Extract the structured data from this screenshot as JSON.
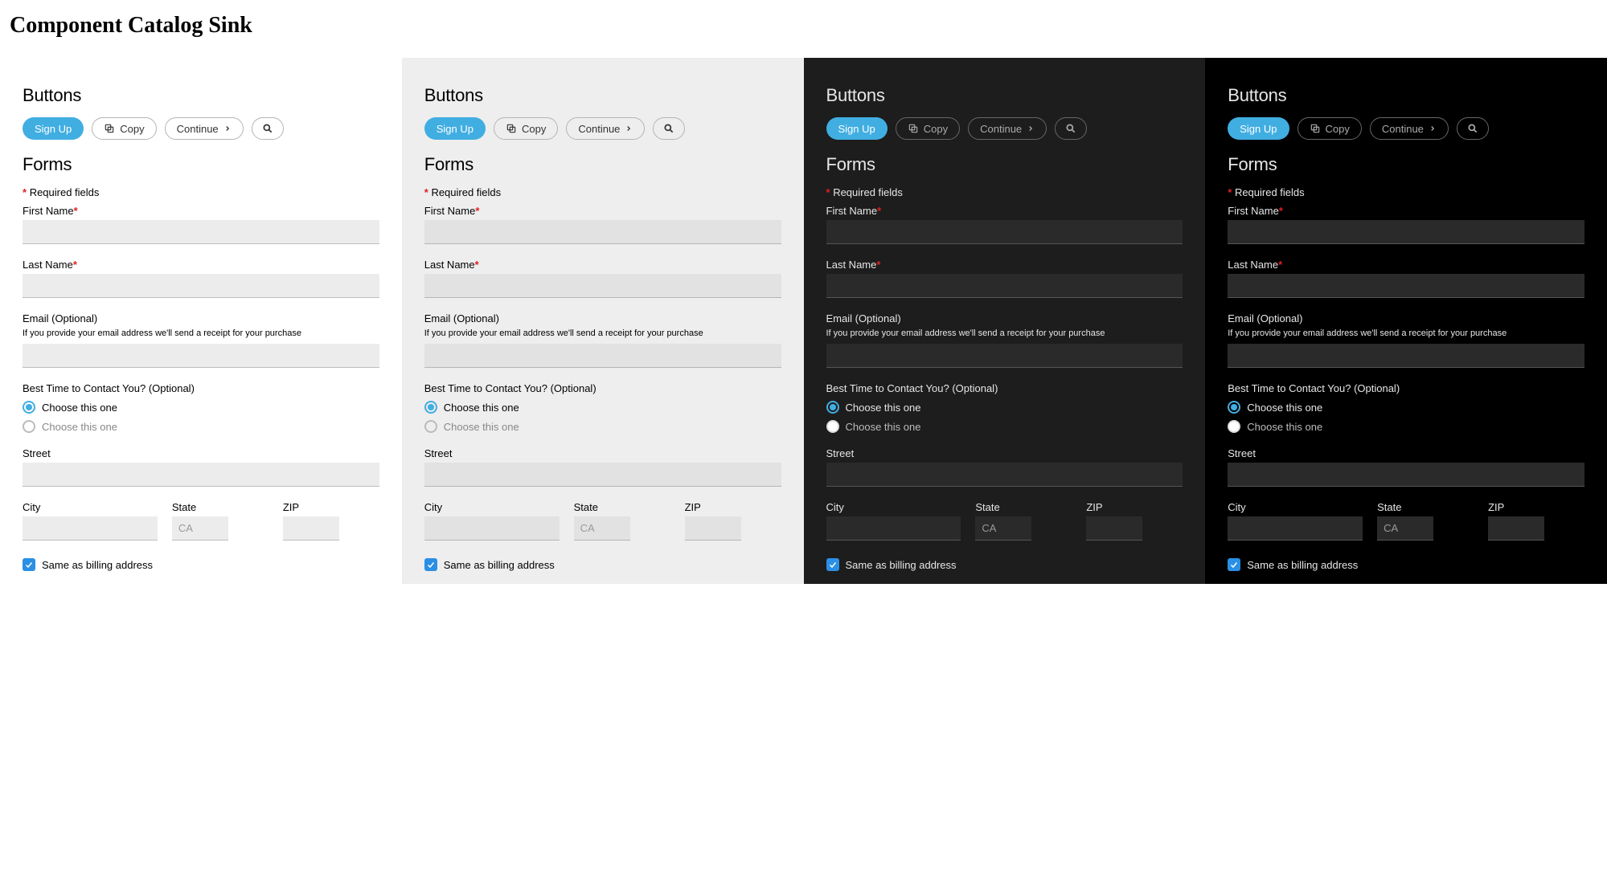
{
  "page": {
    "title": "Component Catalog Sink"
  },
  "sections": {
    "buttons": "Buttons",
    "forms": "Forms"
  },
  "buttons": {
    "signup": "Sign Up",
    "copy": "Copy",
    "continue": "Continue"
  },
  "form": {
    "required_note": "Required fields",
    "first_name_label": "First Name",
    "last_name_label": "Last Name",
    "email_label": "Email (Optional)",
    "email_help": "If you provide your email address we'll send a receipt for your purchase",
    "contact_time_label": "Best Time to Contact You? (Optional)",
    "radio_option": "Choose this one",
    "street_label": "Street",
    "city_label": "City",
    "state_label": "State",
    "state_placeholder": "CA",
    "zip_label": "ZIP",
    "same_billing": "Same as billing address"
  }
}
